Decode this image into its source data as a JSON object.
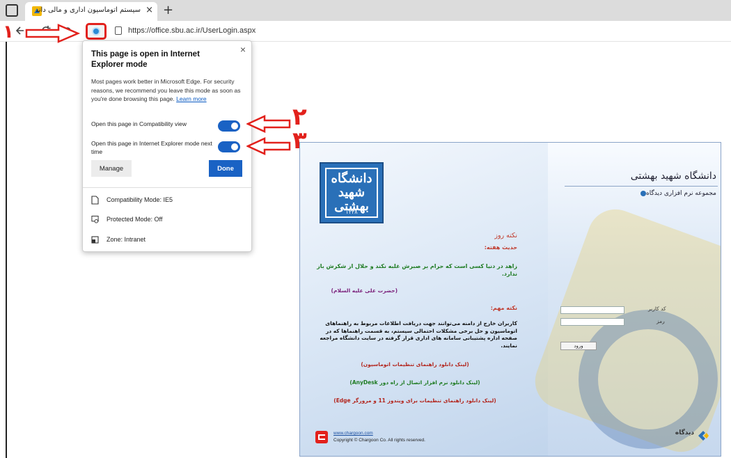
{
  "browser": {
    "tab_title": "سیستم اتوماسیون اداری و مالی دانشگاه",
    "tab_close": "×",
    "new_tab": "+",
    "url": "https://office.sbu.ac.ir/UserLogin.aspx"
  },
  "popup": {
    "title": "This page is open in Internet Explorer mode",
    "description": "Most pages work better in Microsoft Edge. For security reasons, we recommend you leave this mode as soon as you're done browsing this page.",
    "learn_more": "Learn more",
    "option_compat": "Open this page in Compatibility view",
    "option_ie_next": "Open this page in Internet Explorer mode next time",
    "compat_enabled": true,
    "ie_next_enabled": true,
    "manage": "Manage",
    "done": "Done",
    "compat_mode": "Compatibility Mode: IE5",
    "protected_mode": "Protected Mode: Off",
    "zone": "Zone: Intranet",
    "close": "×"
  },
  "annotations": {
    "one": "۱",
    "two": "۲",
    "three": "۳"
  },
  "login": {
    "logo_text": "دانشگاه شهید بهشتی",
    "logo_year": "۱۳۳۸",
    "university": "دانشگاه شهید بهشتی",
    "subtitle": "مجموعه نرم افزاری دیدگاه",
    "tip_title": "نکته روز",
    "hadith_label": "حدیث هفته:",
    "hadith_text": "زاهد در دنیا کسی است که حرام بر صبرش غلبه نکند و حلال از شکرش باز ندارد.",
    "hadith_source": "(حضرت علی علیه السلام)",
    "note_label": "نکته مهم:",
    "note_text": "کاربران خارج از دامنه می‌توانند جهت دریافت اطلاعات مربوط به راهنماهای اتوماسیون و حل برخی مشکلات احتمالی سیستم، به قسمت راهنماها که در صفحه اداره پشتیبانی سامانه های اداری قرار گرفته در سایت دانشگاه مراجعه نمایند.",
    "link1": "(لینک دانلود راهنمای تنظیمات اتوماسیون)",
    "link2": "(لینک دانلود نرم افزار اتصال از راه دور AnyDesk)",
    "link3": "(لینک دانلود راهنمای تنظیمات برای ویندوز 11 و مرورگر Edge)",
    "username_label": "کد کاربر",
    "password_label": "رمز",
    "login_button": "ورود",
    "footer_url": "www.chargoon.com",
    "footer_copy": "Copyright © Chargoon Co. All rights reserved.",
    "brand": "دیدگاه"
  }
}
